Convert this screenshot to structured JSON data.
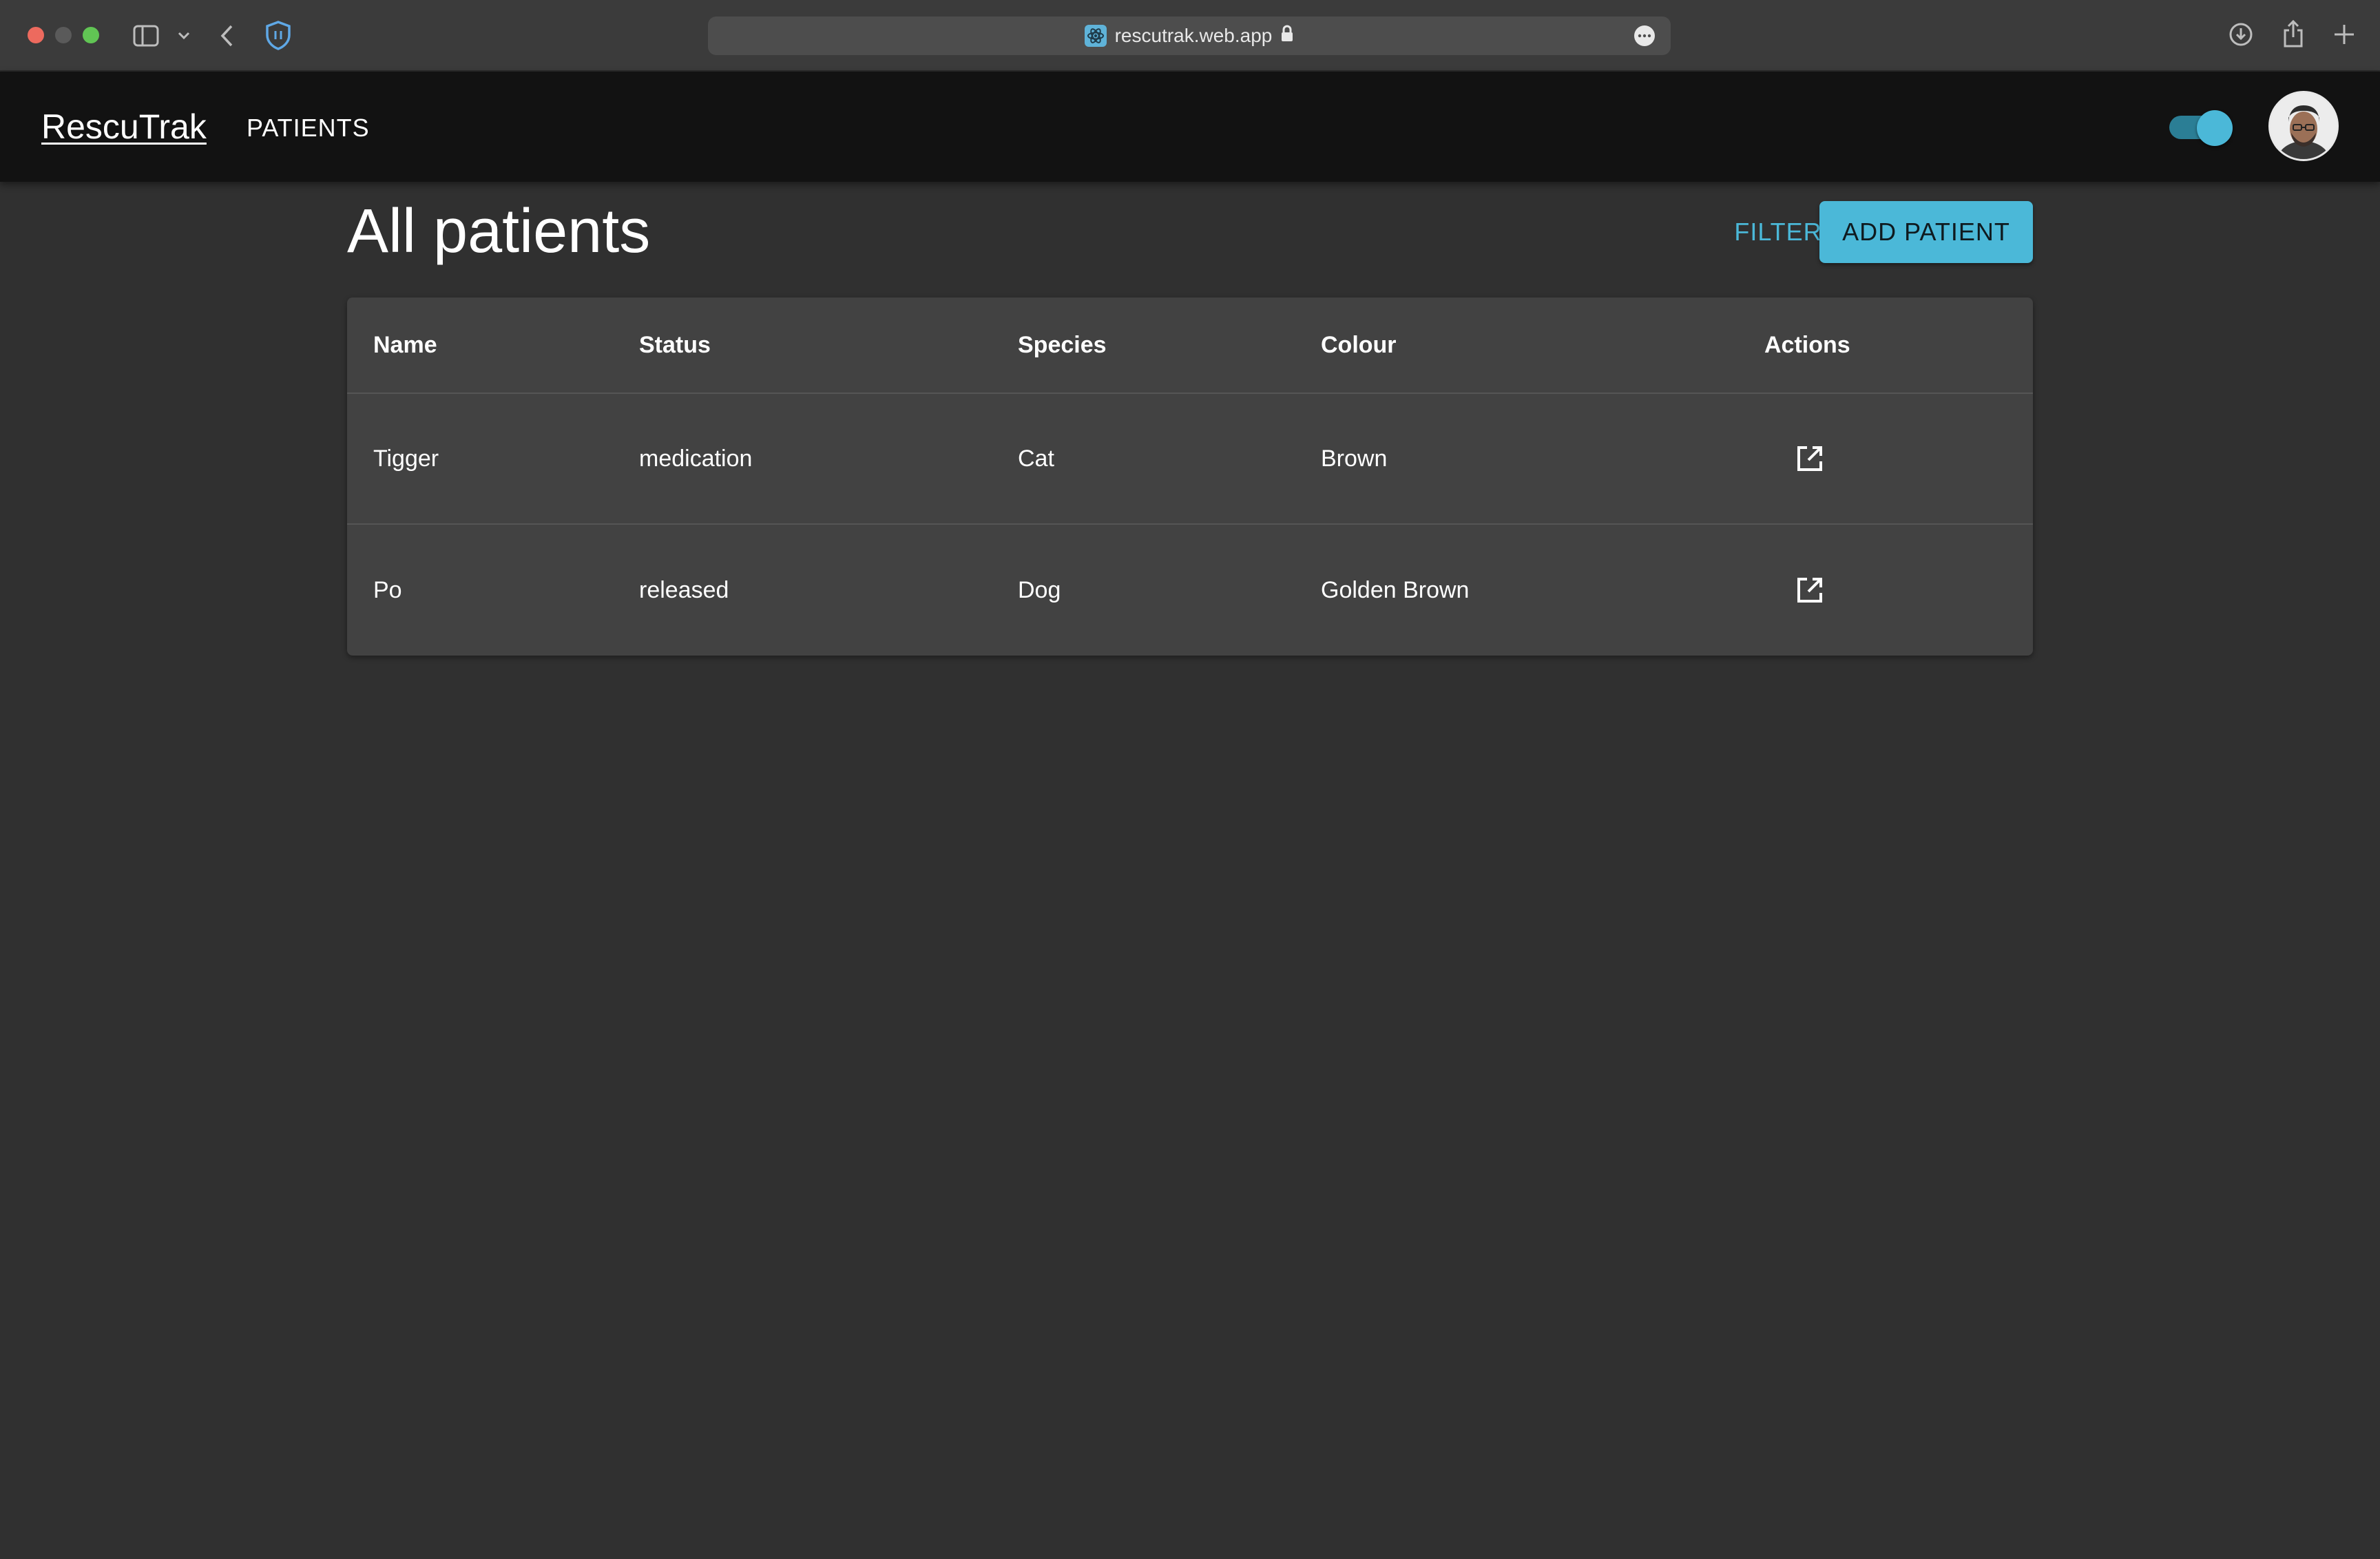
{
  "browser": {
    "url": "rescutrak.web.app",
    "icons": [
      "sidebar-icon",
      "chevron-down-icon",
      "back-icon",
      "shield-icon",
      "site-favicon",
      "lock-icon",
      "more-icon",
      "download-icon",
      "share-icon",
      "new-tab-icon"
    ]
  },
  "header": {
    "brand": "RescuTrak",
    "nav_patients": "PATIENTS",
    "theme_toggle_on": true,
    "accent_color": "#4bb8d8",
    "header_bg": "#121212"
  },
  "main": {
    "title": "All patients",
    "filter_label": "FILTER",
    "add_label": "ADD PATIENT",
    "table": {
      "columns": [
        "Name",
        "Status",
        "Species",
        "Colour",
        "Actions"
      ],
      "rows": [
        {
          "name": "Tigger",
          "status": "medication",
          "species": "Cat",
          "colour": "Brown",
          "action_icon": "open-in-new-icon"
        },
        {
          "name": "Po",
          "status": "released",
          "species": "Dog",
          "colour": "Golden Brown",
          "action_icon": "open-in-new-icon"
        }
      ]
    }
  }
}
